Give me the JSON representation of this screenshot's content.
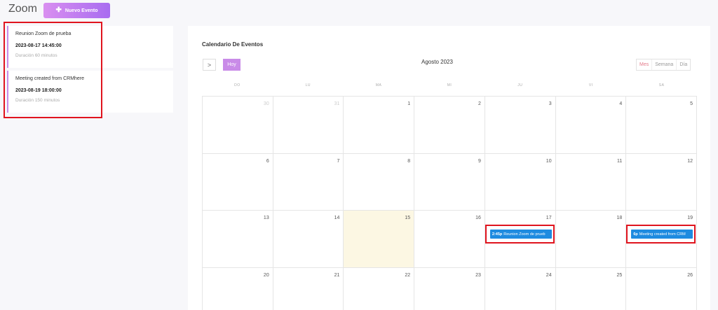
{
  "header": {
    "title": "Zoom",
    "new_event_label": "Nuevo Evento",
    "new_event_icon": "plus-icon"
  },
  "events": [
    {
      "title": "Reunion Zoom de prueba",
      "datetime": "2023-08-17 14:45:00",
      "duration": "Duración 60 minutos"
    },
    {
      "title": "Meeting created from CRMhere",
      "datetime": "2023-08-19 18:00:00",
      "duration": "Duración 150 minutos"
    }
  ],
  "calendar": {
    "heading": "Calendario De Eventos",
    "next_icon": "chevron-right-icon",
    "next_glyph": ">",
    "today_label": "Hoy",
    "month_label": "Agosto 2023",
    "views": {
      "month": "Mes",
      "week": "Semana",
      "day": "Día"
    },
    "active_view": "month",
    "weekdays": [
      "DO",
      "LU",
      "MA",
      "MI",
      "JU",
      "VI",
      "SA"
    ],
    "weeks": [
      [
        "30",
        "31",
        "1",
        "2",
        "3",
        "4",
        "5"
      ],
      [
        "6",
        "7",
        "8",
        "9",
        "10",
        "11",
        "12"
      ],
      [
        "13",
        "14",
        "15",
        "16",
        "17",
        "18",
        "19"
      ],
      [
        "20",
        "21",
        "22",
        "23",
        "24",
        "25",
        "26"
      ]
    ],
    "other_month_days": [
      "30",
      "31"
    ],
    "today": "15",
    "cell_events": [
      {
        "day": "17",
        "time": "2:45p",
        "title": "Reunion Zoom de prueb"
      },
      {
        "day": "19",
        "time": "6p",
        "title": "Meeting created from CRM"
      }
    ]
  },
  "colors": {
    "accent": "#c98be8",
    "event_blue": "#1e8be0",
    "today_bg": "#fcf7e3",
    "highlight": "#e0141e"
  }
}
